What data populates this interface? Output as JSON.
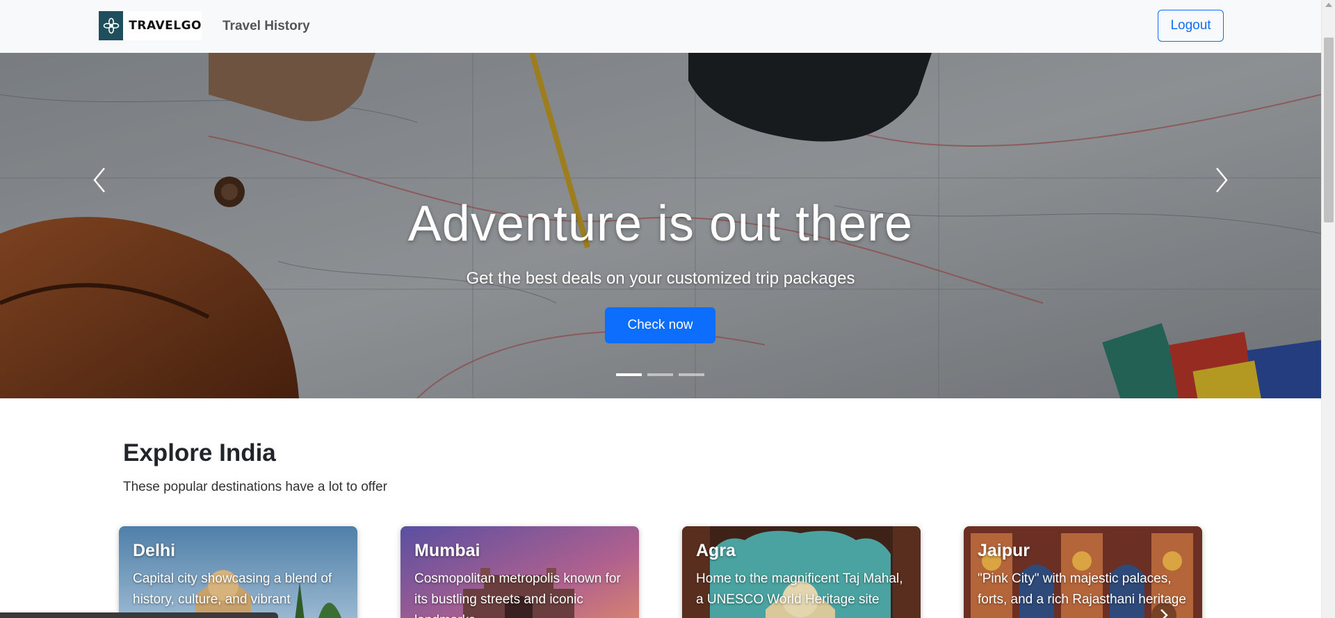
{
  "navbar": {
    "brand_text": "TRAVELGO",
    "travel_history_label": "Travel History",
    "logout_label": "Logout"
  },
  "hero": {
    "title": "Adventure is out there",
    "subtitle": "Get the best deals on your customized trip packages",
    "cta_label": "Check now",
    "slide_count": 3,
    "active_slide": 1
  },
  "explore": {
    "title": "Explore India",
    "subtitle": "These popular destinations have a lot to offer",
    "cards": [
      {
        "name": "Delhi",
        "description": "Capital city showcasing a blend of history, culture, and vibrant"
      },
      {
        "name": "Mumbai",
        "description": "Cosmopolitan metropolis known for its bustling streets and iconic landmarks"
      },
      {
        "name": "Agra",
        "description": "Home to the magnificent Taj Mahal, a UNESCO World Heritage site"
      },
      {
        "name": "Jaipur",
        "description": "\"Pink City\" with majestic palaces, forts, and a rich Rajasthani heritage"
      }
    ]
  },
  "colors": {
    "primary": "#0d6efd",
    "navbar_bg": "#f8f9fa",
    "brand_mark": "#1f4f5c"
  },
  "icons": {
    "brand": "compass-flower-icon",
    "prev": "chevron-left-icon",
    "next": "chevron-right-icon",
    "card_next": "chevron-right-icon"
  }
}
